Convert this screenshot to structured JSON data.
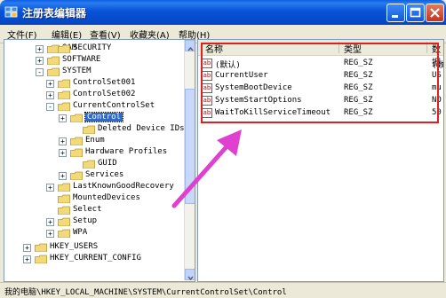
{
  "window": {
    "title": "注册表编辑器"
  },
  "menu": [
    "文件(F)",
    "编辑(E)",
    "查看(V)",
    "收藏夹(A)",
    "帮助(H)"
  ],
  "tree": [
    {
      "label": "SAM",
      "expander": "+"
    },
    {
      "label": "SECURITY",
      "expander": ""
    },
    {
      "label": "SOFTWARE",
      "expander": "+"
    },
    {
      "label": "SYSTEM",
      "expander": "-"
    },
    {
      "label": "ControlSet001",
      "expander": "+"
    },
    {
      "label": "ControlSet002",
      "expander": "+"
    },
    {
      "label": "CurrentControlSet",
      "expander": "-"
    },
    {
      "label": "Control",
      "expander": "+",
      "selected": true
    },
    {
      "label": "Deleted Device IDs",
      "expander": ""
    },
    {
      "label": "Enum",
      "expander": "+"
    },
    {
      "label": "Hardware Profiles",
      "expander": "+"
    },
    {
      "label": "GUID",
      "expander": ""
    },
    {
      "label": "Services",
      "expander": "+"
    },
    {
      "label": "LastKnownGoodRecovery",
      "expander": "+"
    },
    {
      "label": "MountedDevices",
      "expander": ""
    },
    {
      "label": "Select",
      "expander": ""
    },
    {
      "label": "Setup",
      "expander": "+"
    },
    {
      "label": "WPA",
      "expander": "+"
    },
    {
      "label": "HKEY_USERS",
      "expander": "+"
    },
    {
      "label": "HKEY_CURRENT_CONFIG",
      "expander": "+"
    }
  ],
  "list": {
    "columns": {
      "name": "名称",
      "type": "类型",
      "data": "数据"
    },
    "rows": [
      {
        "name": "(默认)",
        "type": "REG_SZ",
        "data": "(数"
      },
      {
        "name": "CurrentUser",
        "type": "REG_SZ",
        "data": "US"
      },
      {
        "name": "SystemBootDevice",
        "type": "REG_SZ",
        "data": "mu"
      },
      {
        "name": "SystemStartOptions",
        "type": "REG_SZ",
        "data": "NO"
      },
      {
        "name": "WaitToKillServiceTimeout",
        "type": "REG_SZ",
        "data": "50"
      }
    ]
  },
  "status": "我的电脑\\HKEY_LOCAL_MACHINE\\SYSTEM\\CurrentControlSet\\Control",
  "colors": {
    "titlebar": "#0853d6",
    "highlight_box": "#e02020",
    "arrow": "#e040d0",
    "selection": "#316ac5"
  }
}
